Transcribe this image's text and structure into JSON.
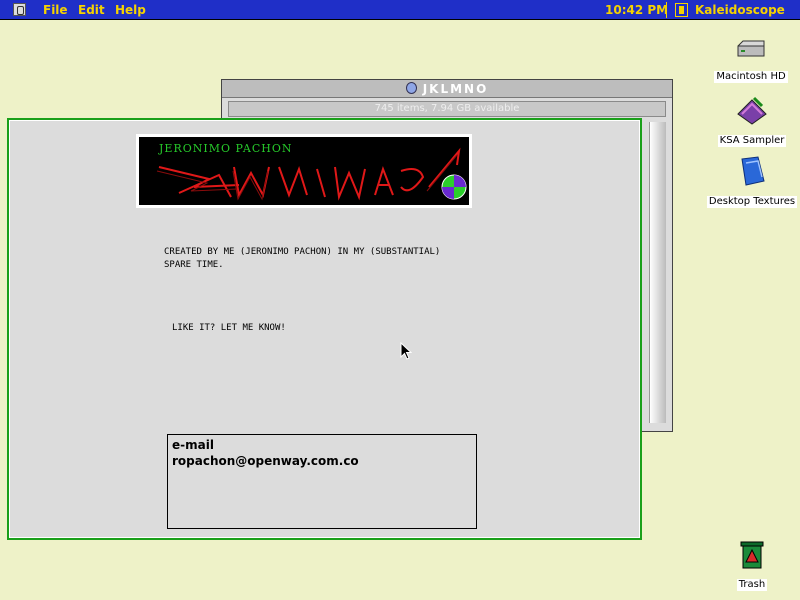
{
  "menubar": {
    "items": [
      "File",
      "Edit",
      "Help"
    ],
    "clock": "10:42 PM",
    "app_name": "Kaleidoscope",
    "text_color": "#f5d200",
    "bg_color": "#1f2fc8"
  },
  "desktop": {
    "icons": [
      {
        "label": "Macintosh HD",
        "icon": "hard-drive-icon"
      },
      {
        "label": "KSA Sampler",
        "icon": "ksa-sampler-icon"
      },
      {
        "label": "Desktop Textures",
        "icon": "folder-icon"
      },
      {
        "label": "Trash",
        "icon": "trash-icon"
      }
    ],
    "bg_color": "#eef2c8"
  },
  "finder_window": {
    "title": "JKLMNO",
    "info": "745 items, 7.94 GB available"
  },
  "about_window": {
    "banner_title": "JERONIMO PACHON",
    "banner_logo": "WORKMAC",
    "description": "CREATED BY ME (JERONIMO PACHON) IN MY (SUBSTANTIAL)\nSPARE TIME.",
    "prompt": "LIKE IT? LET ME KNOW!",
    "contact_label": "e-mail",
    "contact_email": "ropachon@openway.com.co",
    "border_color": "#1aa01a"
  }
}
